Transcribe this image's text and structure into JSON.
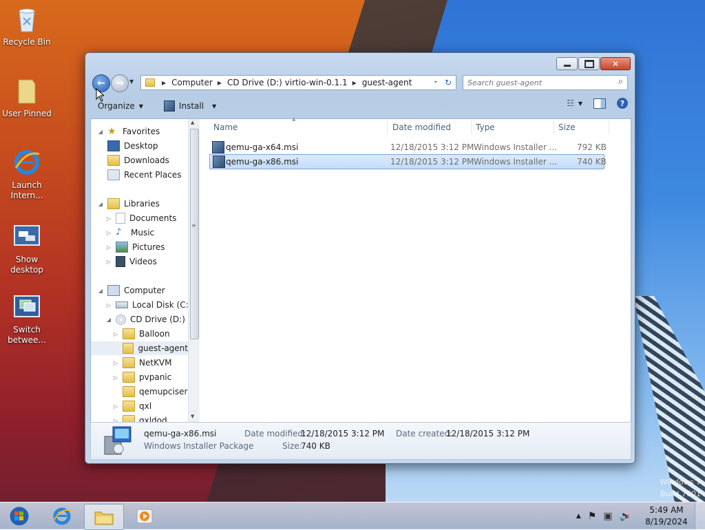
{
  "desktop": {
    "icons": [
      {
        "label": "Recycle Bin",
        "icon": "recycle-bin-icon"
      },
      {
        "label": "User Pinned",
        "icon": "folder-icon"
      },
      {
        "label": "Launch Intern...",
        "icon": "internet-explorer-icon"
      },
      {
        "label": "Show desktop",
        "icon": "show-desktop-icon"
      },
      {
        "label": "Switch betwee...",
        "icon": "switch-windows-icon"
      }
    ],
    "watermark_line1": "Windows 7",
    "watermark_line2": "Build 7601"
  },
  "window": {
    "address": {
      "crumbs": [
        "Computer",
        "CD Drive (D:) virtio-win-0.1.1",
        "guest-agent"
      ]
    },
    "search": {
      "placeholder": "Search guest-agent"
    },
    "toolbar": {
      "organize": "Organize",
      "install": "Install"
    },
    "nav": {
      "favorites": "Favorites",
      "desktop": "Desktop",
      "downloads": "Downloads",
      "recent": "Recent Places",
      "libraries": "Libraries",
      "documents": "Documents",
      "music": "Music",
      "pictures": "Pictures",
      "videos": "Videos",
      "computer": "Computer",
      "local_disk": "Local Disk (C:)",
      "cd_drive": "CD Drive (D:) virt",
      "balloon": "Balloon",
      "guest_agent": "guest-agent",
      "netkvm": "NetKVM",
      "pvpanic": "pvpanic",
      "qemupciserial": "qemupciserial",
      "qxl": "qxl",
      "qxldod": "qxldod"
    },
    "columns": {
      "name": "Name",
      "date": "Date modified",
      "type": "Type",
      "size": "Size"
    },
    "files": [
      {
        "name": "qemu-ga-x64.msi",
        "date": "12/18/2015 3:12 PM",
        "type": "Windows Installer ...",
        "size": "792 KB"
      },
      {
        "name": "qemu-ga-x86.msi",
        "date": "12/18/2015 3:12 PM",
        "type": "Windows Installer ...",
        "size": "740 KB"
      }
    ],
    "details": {
      "filename": "qemu-ga-x86.msi",
      "filetype": "Windows Installer Package",
      "date_modified_label": "Date modified:",
      "date_modified": "12/18/2015 3:12 PM",
      "date_created_label": "Date created:",
      "date_created": "12/18/2015 3:12 PM",
      "size_label": "Size:",
      "size": "740 KB"
    }
  },
  "taskbar": {
    "time": "5:49 AM",
    "date": "8/19/2024"
  }
}
